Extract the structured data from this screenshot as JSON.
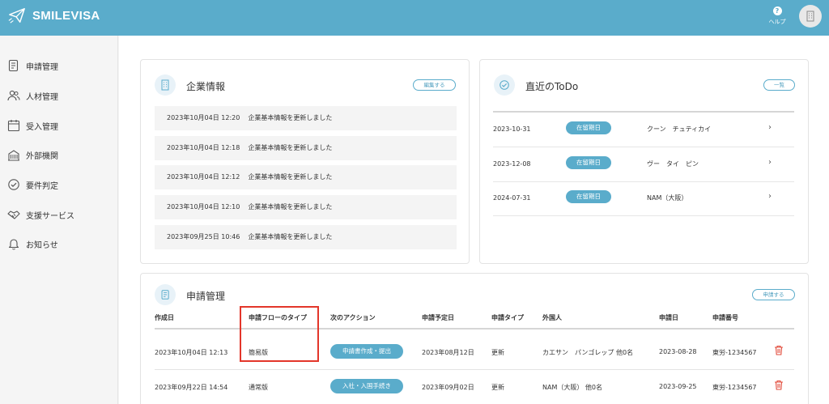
{
  "app": {
    "brand": "SMILEVISA",
    "help_label": "ヘルプ"
  },
  "sidebar": {
    "items": [
      {
        "label": "申請管理",
        "icon": "application-icon"
      },
      {
        "label": "人材管理",
        "icon": "users-icon"
      },
      {
        "label": "受入管理",
        "icon": "calendar-icon"
      },
      {
        "label": "外部機関",
        "icon": "building-icon"
      },
      {
        "label": "要件判定",
        "icon": "check-circle-icon"
      },
      {
        "label": "支援サービス",
        "icon": "handshake-icon"
      },
      {
        "label": "お知らせ",
        "icon": "bell-icon"
      }
    ]
  },
  "company_card": {
    "title": "企業情報",
    "edit_label": "編集する",
    "logs": [
      {
        "time": "2023年10月04日 12:20",
        "message": "企業基本情報を更新しました"
      },
      {
        "time": "2023年10月04日 12:18",
        "message": "企業基本情報を更新しました"
      },
      {
        "time": "2023年10月04日 12:12",
        "message": "企業基本情報を更新しました"
      },
      {
        "time": "2023年10月04日 12:10",
        "message": "企業基本情報を更新しました"
      },
      {
        "time": "2023年09月25日 10:46",
        "message": "企業基本情報を更新しました"
      }
    ]
  },
  "todo_card": {
    "title": "直近のToDo",
    "list_label": "一覧",
    "rows": [
      {
        "date": "2023-10-31",
        "badge": "在留期日",
        "name": "クーン　チュティカイ"
      },
      {
        "date": "2023-12-08",
        "badge": "在留期日",
        "name": "ヴー　タイ　ピン"
      },
      {
        "date": "2024-07-31",
        "badge": "在留期日",
        "name": "NAM（大阪）"
      }
    ]
  },
  "application_card": {
    "title": "申請管理",
    "apply_label": "申請する",
    "columns": [
      "作成日",
      "申請フローのタイプ",
      "次のアクション",
      "申請予定日",
      "申請タイプ",
      "外国人",
      "申請日",
      "申請番号"
    ],
    "rows": [
      {
        "created": "2023年10月04日 12:13",
        "flow_type": "簡易版",
        "action": "申請書作成・提出",
        "planned": "2023年08月12日",
        "type": "更新",
        "foreigner": "カエサン　パンゴレップ 他0名",
        "applied": "2023-08-28",
        "number": "東労-1234567"
      },
      {
        "created": "2023年09月22日 14:54",
        "flow_type": "通常版",
        "action": "入社・入国手続き",
        "planned": "2023年09月02日",
        "type": "更新",
        "foreigner": "NAM（大阪） 他0名",
        "applied": "2023-09-25",
        "number": "東労-1234567"
      }
    ]
  },
  "colors": {
    "accent": "#5aaccb",
    "highlight": "#e3362a",
    "delete": "#e24b3b"
  }
}
